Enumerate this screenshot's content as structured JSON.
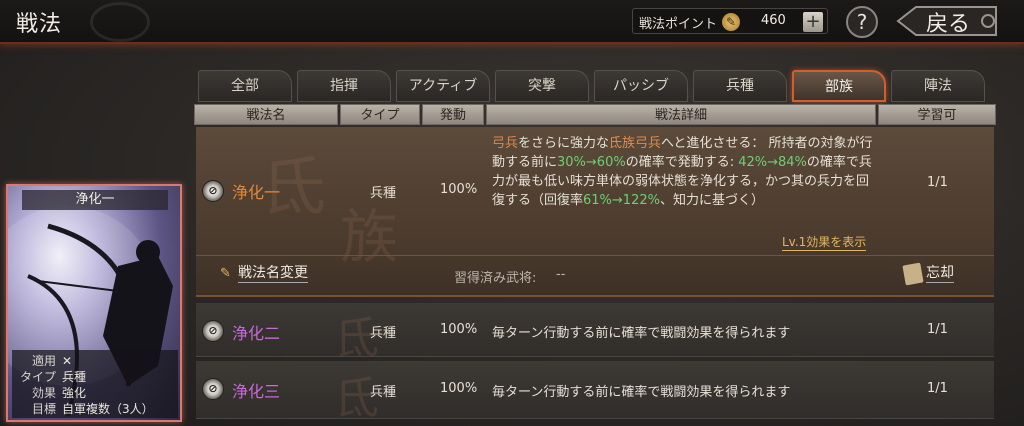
{
  "header": {
    "title": "戦法",
    "points_label": "戦法ポイント",
    "points_icon": "skill-point-icon",
    "points_value": "460",
    "plus_label": "+",
    "help_label": "?",
    "back_label": "戻る"
  },
  "tabs": [
    {
      "label": "全部",
      "active": false
    },
    {
      "label": "指揮",
      "active": false
    },
    {
      "label": "アクティブ",
      "active": false
    },
    {
      "label": "突撃",
      "active": false
    },
    {
      "label": "パッシブ",
      "active": false
    },
    {
      "label": "兵種",
      "active": false
    },
    {
      "label": "部族",
      "active": true
    },
    {
      "label": "陣法",
      "active": false
    }
  ],
  "columns": {
    "name": "戦法名",
    "type": "タイプ",
    "trigger": "発動",
    "detail": "戦法詳細",
    "learnable": "学習可"
  },
  "rows": [
    {
      "name": "浄化一",
      "type": "兵種",
      "trigger": "100%",
      "learnable": "1/1",
      "desc": {
        "p1": "弓兵",
        "p2": "をさらに強力な",
        "p3": "氐族弓兵",
        "p4": "へと進化させる： 所持者の対象が行動する前に",
        "p5": "30%→60%",
        "p6": "の確率で発動する: ",
        "p7": "42%→84%",
        "p8": "の確率で兵力が最も低い味方単体の弱体状態を浄化する，かつ其の兵力を回復する（回復率",
        "p9": "61%→122%",
        "p10": "、知力に基づく）"
      },
      "effect_link": "Lv.1効果を表示",
      "rename_label": "戦法名変更",
      "learned_label": "習得済み武将:",
      "learned_value": "--",
      "forget_label": "忘却",
      "watermark1": "氐",
      "watermark2": "族"
    },
    {
      "name": "浄化二",
      "type": "兵種",
      "trigger": "100%",
      "detail": "毎ターン行動する前に確率で戦闘効果を得られます",
      "learnable": "1/1",
      "watermark": "氐"
    },
    {
      "name": "浄化三",
      "type": "兵種",
      "trigger": "100%",
      "detail": "毎ターン行動する前に確率で戦闘効果を得られます",
      "learnable": "1/1",
      "watermark": "氐"
    }
  ],
  "card": {
    "title": "浄化一",
    "apply_key": "適用",
    "apply_icon": "crossed-bows-icon",
    "type_key": "タイプ",
    "type_value": "兵種",
    "effect_key": "効果",
    "effect_value": "強化",
    "target_key": "目標",
    "target_value": "自軍複数（3人）"
  },
  "colors": {
    "accent_orange": "#e08a4a",
    "percent_green": "#6fcf72",
    "name_orange": "#e0873a",
    "name_purple": "#c56ad6",
    "link_gold": "#e2b75a",
    "active_tab_border": "#d15f2e"
  }
}
